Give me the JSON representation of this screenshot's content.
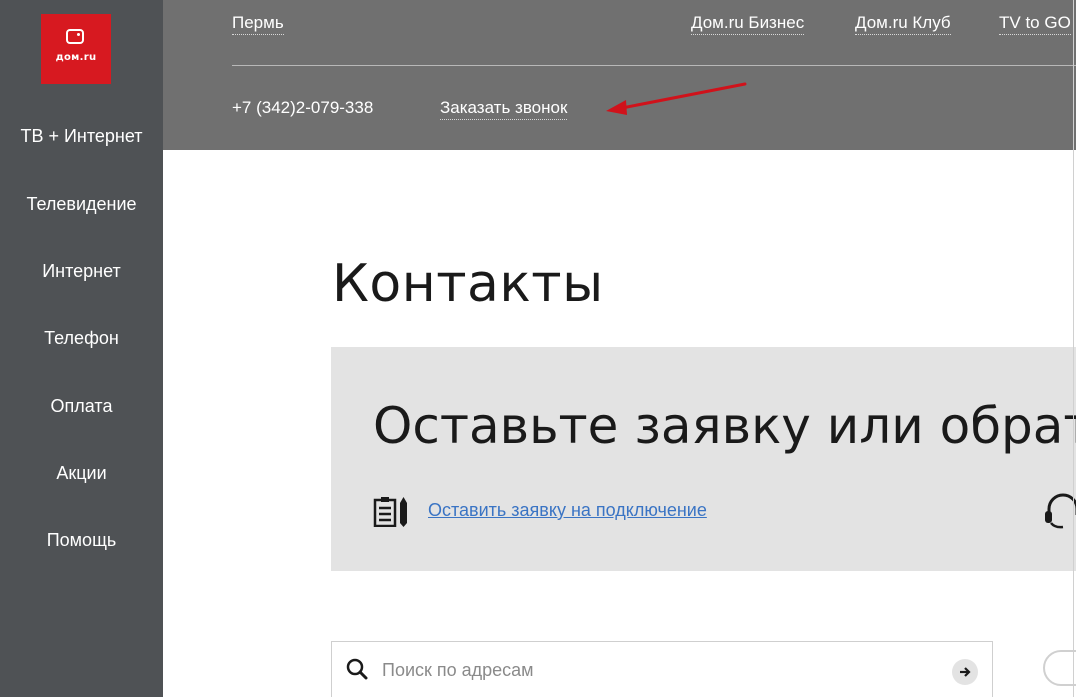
{
  "sidebar": {
    "logo_text": "дом.ru",
    "items": [
      {
        "label": "ТВ + Интернет"
      },
      {
        "label": "Телевидение"
      },
      {
        "label": "Интернет"
      },
      {
        "label": "Телефон"
      },
      {
        "label": "Оплата"
      },
      {
        "label": "Акции"
      },
      {
        "label": "Помощь"
      }
    ]
  },
  "header": {
    "city": "Пермь",
    "links": [
      "Дом.ru Бизнес",
      "Дом.ru Клуб",
      "TV to GO"
    ],
    "phone": "+7 (342)2-079-338",
    "callback": "Заказать звонок"
  },
  "main": {
    "title": "Контакты",
    "panel": {
      "heading": "Оставьте заявку или обратитесь",
      "apply_link": "Оставить заявку на подключение"
    },
    "search": {
      "placeholder": "Поиск по адресам"
    }
  },
  "colors": {
    "brand_red": "#d71920",
    "sidebar_bg": "#4f5255",
    "topbar_bg": "#707070",
    "panel_bg": "#e3e3e3",
    "link_blue": "#3a74c4",
    "annotation_arrow": "#d0121b"
  },
  "icons": [
    "logo-mark-icon",
    "document-pencil-icon",
    "headset-icon",
    "search-icon",
    "arrow-right-icon"
  ]
}
